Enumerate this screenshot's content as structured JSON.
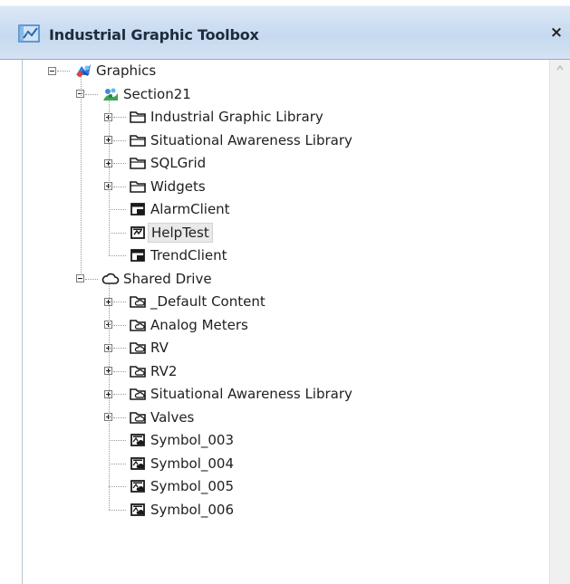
{
  "window": {
    "title": "Industrial Graphic Toolbox",
    "close_glyph": "×",
    "title_icon": "toolbox-icon"
  },
  "tree": {
    "root": {
      "label": "Graphics",
      "icon": "graphics-icon",
      "expanded": true
    },
    "sections": [
      {
        "label": "Section21",
        "icon": "galaxy-icon",
        "expanded": true,
        "children": [
          {
            "label": "Industrial Graphic Library",
            "icon": "folder-icon",
            "expandable": true
          },
          {
            "label": "Situational Awareness Library",
            "icon": "folder-icon",
            "expandable": true
          },
          {
            "label": "SQLGrid",
            "icon": "folder-icon",
            "expandable": true
          },
          {
            "label": "Widgets",
            "icon": "folder-icon",
            "expandable": true
          },
          {
            "label": "AlarmClient",
            "icon": "client-control-icon",
            "expandable": false
          },
          {
            "label": "HelpTest",
            "icon": "symbol-icon",
            "expandable": false,
            "selected": true
          },
          {
            "label": "TrendClient",
            "icon": "client-control-icon",
            "expandable": false
          }
        ]
      },
      {
        "label": "Shared Drive",
        "icon": "cloud-icon",
        "expanded": true,
        "children": [
          {
            "label": "_Default Content",
            "icon": "shared-folder-icon",
            "expandable": true
          },
          {
            "label": "Analog Meters",
            "icon": "shared-folder-icon",
            "expandable": true
          },
          {
            "label": "RV",
            "icon": "shared-folder-icon",
            "expandable": true
          },
          {
            "label": "RV2",
            "icon": "shared-folder-icon",
            "expandable": true
          },
          {
            "label": "Situational Awareness Library",
            "icon": "shared-folder-icon",
            "expandable": true
          },
          {
            "label": "Valves",
            "icon": "shared-folder-icon",
            "expandable": true
          },
          {
            "label": "Symbol_003",
            "icon": "shared-symbol-icon",
            "expandable": false
          },
          {
            "label": "Symbol_004",
            "icon": "shared-symbol-icon",
            "expandable": false
          },
          {
            "label": "Symbol_005",
            "icon": "shared-symbol-icon",
            "expandable": false
          },
          {
            "label": "Symbol_006",
            "icon": "shared-symbol-icon",
            "expandable": false
          }
        ]
      }
    ]
  },
  "colors": {
    "titlebar": "#c6d9ef",
    "selection": "#e9e9e9"
  }
}
